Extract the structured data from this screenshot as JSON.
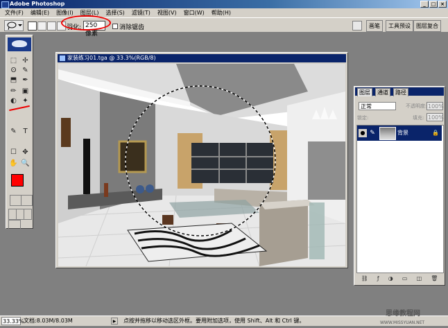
{
  "app": {
    "title": "Adobe Photoshop"
  },
  "window_buttons": [
    "_",
    "□",
    "×"
  ],
  "menu": [
    "文件(F)",
    "编辑(E)",
    "图像(I)",
    "图层(L)",
    "选择(S)",
    "滤镜(T)",
    "视图(V)",
    "窗口(W)",
    "帮助(H)"
  ],
  "options": {
    "feather_label": "羽化:",
    "feather_value": "250 像素",
    "antialias_label": "消除锯齿",
    "palette_tabs": [
      "画笔",
      "工具预设",
      "图层复合"
    ]
  },
  "toolbox": {
    "tools": [
      "⬚",
      "✢",
      "ʘ",
      "✎",
      "⬒",
      "✒",
      "✏",
      "▣",
      "◐",
      "✦",
      "T",
      "✎",
      "☐",
      "✥",
      "✋",
      "🔍"
    ]
  },
  "document": {
    "title": "家装练习01.tga @ 33.3%(RGB/8)"
  },
  "layers_panel": {
    "tabs": [
      "图层",
      "通道",
      "路径"
    ],
    "blend_mode": "正常",
    "opacity_label": "不透明度:",
    "opacity_value": "100%",
    "lock_label": "锁定:",
    "fill_label": "填充:",
    "fill_value": "100%",
    "layer_name": "背景",
    "footer_icons": [
      "⛓",
      "ƒ",
      "◑",
      "▭",
      "◫",
      "🗑"
    ]
  },
  "status": {
    "zoom": "33.33%",
    "doc_size": "文档:8.03M/8.03M",
    "message": "点按并拖移以移动选区外框。要用附加选项，使用 Shift、Alt 和 Ctrl 键。"
  },
  "watermark": {
    "name": "思缘教程网",
    "url": "WWW.MISSYUAN.NET"
  },
  "colors": {
    "foreground": "#ff0000",
    "background": "#ffffff",
    "title_blue": "#0a246a"
  }
}
